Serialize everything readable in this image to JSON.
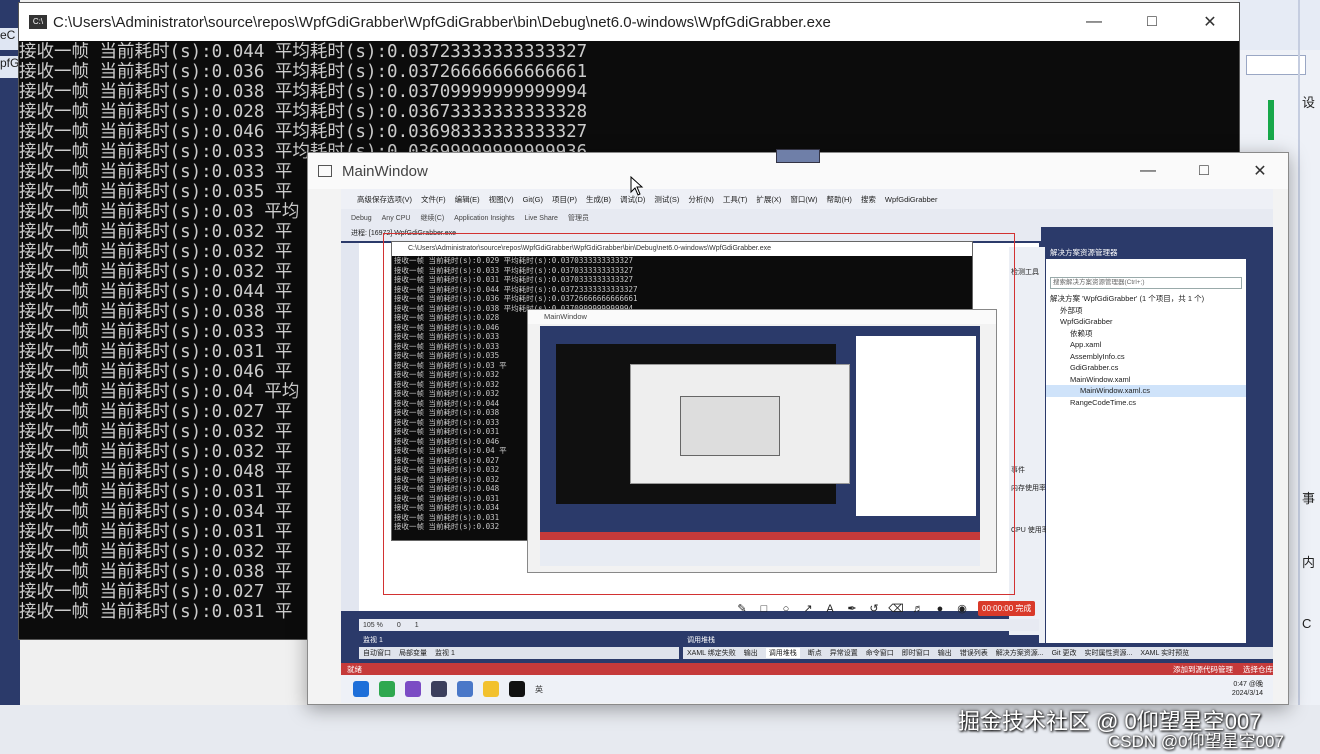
{
  "console": {
    "title": "C:\\Users\\Administrator\\source\\repos\\WpfGdiGrabber\\WpfGdiGrabber\\bin\\Debug\\net6.0-windows\\WpfGdiGrabber.exe",
    "icon": "console-app-icon",
    "lines": [
      "接收一帧 当前耗时(s):0.044 平均耗时(s):0.03723333333333327",
      "接收一帧 当前耗时(s):0.036 平均耗时(s):0.03726666666666661",
      "接收一帧 当前耗时(s):0.038 平均耗时(s):0.03709999999999994",
      "接收一帧 当前耗时(s):0.028 平均耗时(s):0.03673333333333328",
      "接收一帧 当前耗时(s):0.046 平均耗时(s):0.03698333333333327",
      "接收一帧 当前耗时(s):0.033 平均耗时(s):0.03699999999999936",
      "接收一帧 当前耗时(s):0.033 平",
      "接收一帧 当前耗时(s):0.035 平",
      "接收一帧 当前耗时(s):0.03 平均",
      "接收一帧 当前耗时(s):0.032 平",
      "接收一帧 当前耗时(s):0.032 平",
      "接收一帧 当前耗时(s):0.032 平",
      "接收一帧 当前耗时(s):0.044 平",
      "接收一帧 当前耗时(s):0.038 平",
      "接收一帧 当前耗时(s):0.033 平",
      "接收一帧 当前耗时(s):0.031 平",
      "接收一帧 当前耗时(s):0.046 平",
      "接收一帧 当前耗时(s):0.04 平均",
      "接收一帧 当前耗时(s):0.027 平",
      "接收一帧 当前耗时(s):0.032 平",
      "接收一帧 当前耗时(s):0.032 平",
      "接收一帧 当前耗时(s):0.048 平",
      "接收一帧 当前耗时(s):0.031 平",
      "接收一帧 当前耗时(s):0.034 平",
      "接收一帧 当前耗时(s):0.031 平",
      "接收一帧 当前耗时(s):0.032 平",
      "接收一帧 当前耗时(s):0.038 平",
      "接收一帧 当前耗时(s):0.027 平",
      "接收一帧 当前耗时(s):0.031 平"
    ]
  },
  "mainwindow": {
    "title": "MainWindow"
  },
  "capture": {
    "vs_menu": [
      "高级保存选项(V)",
      "文件(F)",
      "编辑(E)",
      "视图(V)",
      "Git(G)",
      "项目(P)",
      "生成(B)",
      "调试(D)",
      "测试(S)",
      "分析(N)",
      "工具(T)",
      "扩展(X)",
      "窗口(W)",
      "帮助(H)",
      "搜索",
      "WpfGdiGrabber"
    ],
    "vs_toolbar": [
      "Debug",
      "Any CPU",
      "继续(C)",
      "Application Insights",
      "Live Share",
      "管理员"
    ],
    "vs_process": "进程: [16972] WpfGdiGrabber.exe",
    "inner_console_title": "C:\\Users\\Administrator\\source\\repos\\WpfGdiGrabber\\WpfGdiGrabber\\bin\\Debug\\net6.0-windows\\WpfGdiGrabber.exe",
    "inner_console_lines": [
      "接收一帧 当前耗时(s):0.029 平均耗时(s):0.0370333333333327",
      "接收一帧 当前耗时(s):0.033 平均耗时(s):0.0370333333333327",
      "接收一帧 当前耗时(s):0.031 平均耗时(s):0.0370333333333327",
      "接收一帧 当前耗时(s):0.044 平均耗时(s):0.03723333333333327",
      "接收一帧 当前耗时(s):0.036 平均耗时(s):0.03726666666666661",
      "接收一帧 当前耗时(s):0.038 平均耗时(s):0.0370999999999994",
      "接收一帧 当前耗时(s):0.028",
      "接收一帧 当前耗时(s):0.046",
      "接收一帧 当前耗时(s):0.033",
      "接收一帧 当前耗时(s):0.033",
      "接收一帧 当前耗时(s):0.035",
      "接收一帧 当前耗时(s):0.03 平",
      "接收一帧 当前耗时(s):0.032",
      "接收一帧 当前耗时(s):0.032",
      "接收一帧 当前耗时(s):0.032",
      "接收一帧 当前耗时(s):0.044",
      "接收一帧 当前耗时(s):0.038",
      "接收一帧 当前耗时(s):0.033",
      "接收一帧 当前耗时(s):0.031",
      "接收一帧 当前耗时(s):0.046",
      "接收一帧 当前耗时(s):0.04 平",
      "接收一帧 当前耗时(s):0.027",
      "接收一帧 当前耗时(s):0.032",
      "接收一帧 当前耗时(s):0.032",
      "接收一帧 当前耗时(s):0.048",
      "接收一帧 当前耗时(s):0.031",
      "接收一帧 当前耗时(s):0.034",
      "接收一帧 当前耗时(s):0.031",
      "接收一帧 当前耗时(s):0.032"
    ],
    "inner_main_title": "MainWindow",
    "explorer_header": "解决方案资源管理器",
    "explorer_search": "搜索解决方案资源管理器(Ctrl+;)",
    "explorer_items": [
      "解决方案 'WpfGdiGrabber' (1 个项目，共 1 个)",
      "外部项",
      "WpfGdiGrabber",
      "依赖项",
      "App.xaml",
      "AssemblyInfo.cs",
      "GdiGrabber.cs",
      "MainWindow.xaml",
      "MainWindow.xaml.cs",
      "RangeCodeTime.cs"
    ],
    "mid_labels": [
      "检测工具",
      "事件",
      "内存使用率",
      "CPU 使用率"
    ],
    "rec_timer": "00:00:00 完成",
    "zoom": "105 %",
    "status_errors": "0",
    "status_warnings": "1",
    "panel_watch": "监视 1",
    "panel_callstack": "调用堆栈",
    "tabs_left": [
      "自动窗口",
      "局部变量",
      "监视 1"
    ],
    "tabs_right": [
      "XAML 绑定失败",
      "输出",
      "调用堆栈",
      "断点",
      "异常设置",
      "命令窗口",
      "即时窗口",
      "输出",
      "错误列表",
      "解决方案资源...",
      "Git 更改",
      "实时属性资源...",
      "XAML 实时预览"
    ],
    "redbar_left": "就绪",
    "redbar_right": "添加到源代码管理",
    "redbar_repo": "选择仓库",
    "clock_time": "0:47 @晚",
    "clock_date": "2024/3/14",
    "ime": "英"
  },
  "background": {
    "left_tab1": "eC",
    "left_tab2": "pfG",
    "right_chips": [
      "设",
      "事",
      "内",
      "C"
    ]
  },
  "watermark": {
    "line1": "掘金技术社区 @ 0仰望星空007",
    "line2": "CSDN @0仰望星空007"
  }
}
